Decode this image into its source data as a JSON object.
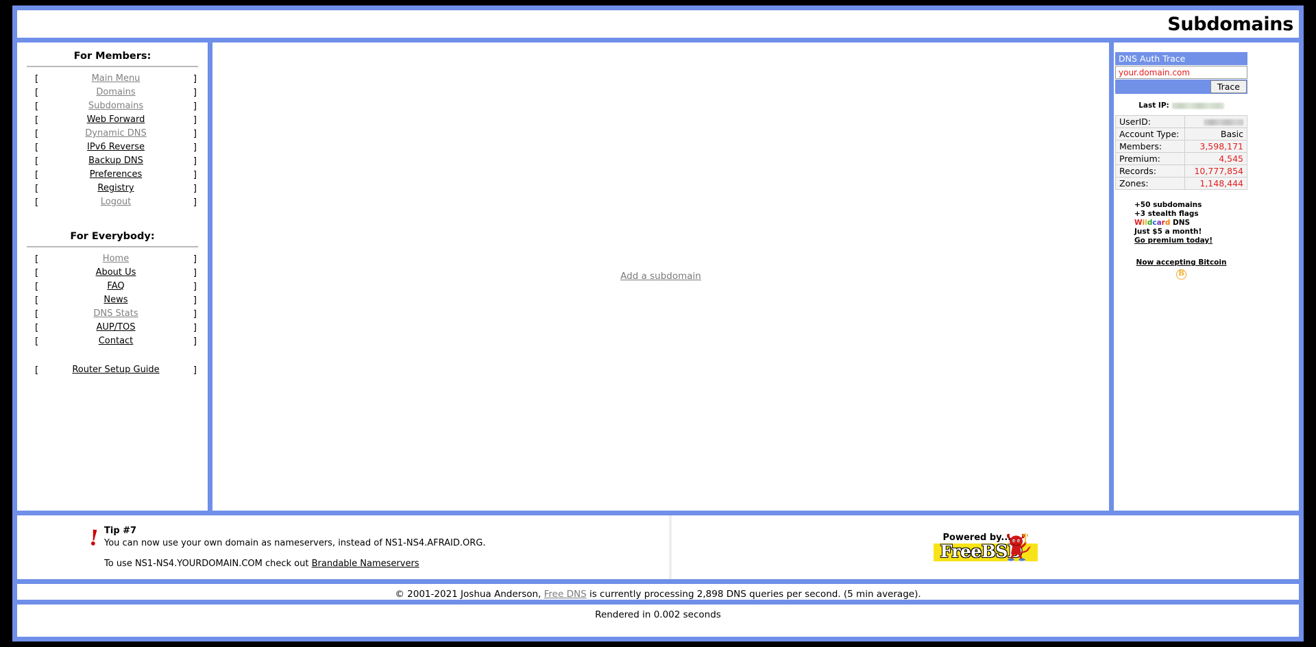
{
  "header": {
    "title": "Subdomains"
  },
  "sidebar": {
    "members_heading": "For Members:",
    "members_items": [
      {
        "label": "Main Menu",
        "state": "muted"
      },
      {
        "label": "Domains",
        "state": "muted"
      },
      {
        "label": "Subdomains",
        "state": "muted"
      },
      {
        "label": "Web Forward",
        "state": "active"
      },
      {
        "label": "Dynamic DNS",
        "state": "muted"
      },
      {
        "label": "IPv6 Reverse",
        "state": "active"
      },
      {
        "label": "Backup DNS",
        "state": "active"
      },
      {
        "label": "Preferences",
        "state": "active"
      },
      {
        "label": "Registry",
        "state": "active"
      },
      {
        "label": "Logout",
        "state": "muted"
      }
    ],
    "everybody_heading": "For Everybody:",
    "everybody_items": [
      {
        "label": "Home",
        "state": "muted"
      },
      {
        "label": "About Us",
        "state": "active"
      },
      {
        "label": "FAQ",
        "state": "active"
      },
      {
        "label": "News",
        "state": "active"
      },
      {
        "label": "DNS Stats",
        "state": "muted"
      },
      {
        "label": "AUP/TOS",
        "state": "active"
      },
      {
        "label": "Contact",
        "state": "active"
      }
    ],
    "extra_items": [
      {
        "label": "Router Setup Guide",
        "state": "active"
      }
    ],
    "bracket_open": "[",
    "bracket_close": "]"
  },
  "main": {
    "add_subdomain_label": "Add a subdomain"
  },
  "trace": {
    "panel_title": "DNS Auth Trace",
    "input_value": "your.domain.com",
    "input_placeholder": "your.domain.com",
    "button_label": "Trace"
  },
  "lastip": {
    "label": "Last IP:",
    "value": ""
  },
  "stats": {
    "rows": [
      {
        "label": "UserID:",
        "value": "",
        "numeric": false,
        "redacted": true
      },
      {
        "label": "Account Type:",
        "value": "Basic",
        "numeric": false,
        "redacted": false
      },
      {
        "label": "Members:",
        "value": "3,598,171",
        "numeric": true,
        "redacted": false
      },
      {
        "label": "Premium:",
        "value": "4,545",
        "numeric": true,
        "redacted": false
      },
      {
        "label": "Records:",
        "value": "10,777,854",
        "numeric": true,
        "redacted": false
      },
      {
        "label": "Zones:",
        "value": "1,148,444",
        "numeric": true,
        "redacted": false
      }
    ]
  },
  "promo": {
    "line1": "+50 subdomains",
    "line2": "+3 stealth flags",
    "wildcard_word": "Wildcard",
    "wildcard_suffix": " DNS",
    "line4": "Just $5 a month!",
    "cta": "Go premium today!",
    "bitcoin_link": "Now accepting Bitcoin",
    "bitcoin_symbol": "B",
    "wildcard_colors": [
      "#e02020",
      "#f08000",
      "#d8c400",
      "#2aa02a",
      "#2060d8",
      "#7030c0",
      "#e02020",
      "#f08000"
    ]
  },
  "tip": {
    "heading": "Tip #7",
    "line1": "You can now use your own domain as nameservers, instead of NS1-NS4.AFRAID.ORG.",
    "line2_prefix": "To use NS1-NS4.YOURDOMAIN.COM check out ",
    "line2_link": "Brandable Nameservers",
    "icon_glyph": "!"
  },
  "bsd": {
    "powered_label": "Powered by...",
    "name_label": "FreeBSD"
  },
  "footer": {
    "copyright_prefix": "© 2001-2021 Joshua Anderson, ",
    "brand_link": "Free DNS",
    "copyright_suffix": " is currently processing 2,898 DNS queries per second. (5 min average).",
    "render_time": "Rendered in 0.002 seconds"
  },
  "colors": {
    "frame_blue": "#6f8fe8",
    "panel_blue": "#7191e8",
    "stat_red": "#e22020",
    "tip_red": "#cc0000",
    "bsd_yellow": "#f8e318",
    "bitcoin_orange": "#f0a821"
  }
}
